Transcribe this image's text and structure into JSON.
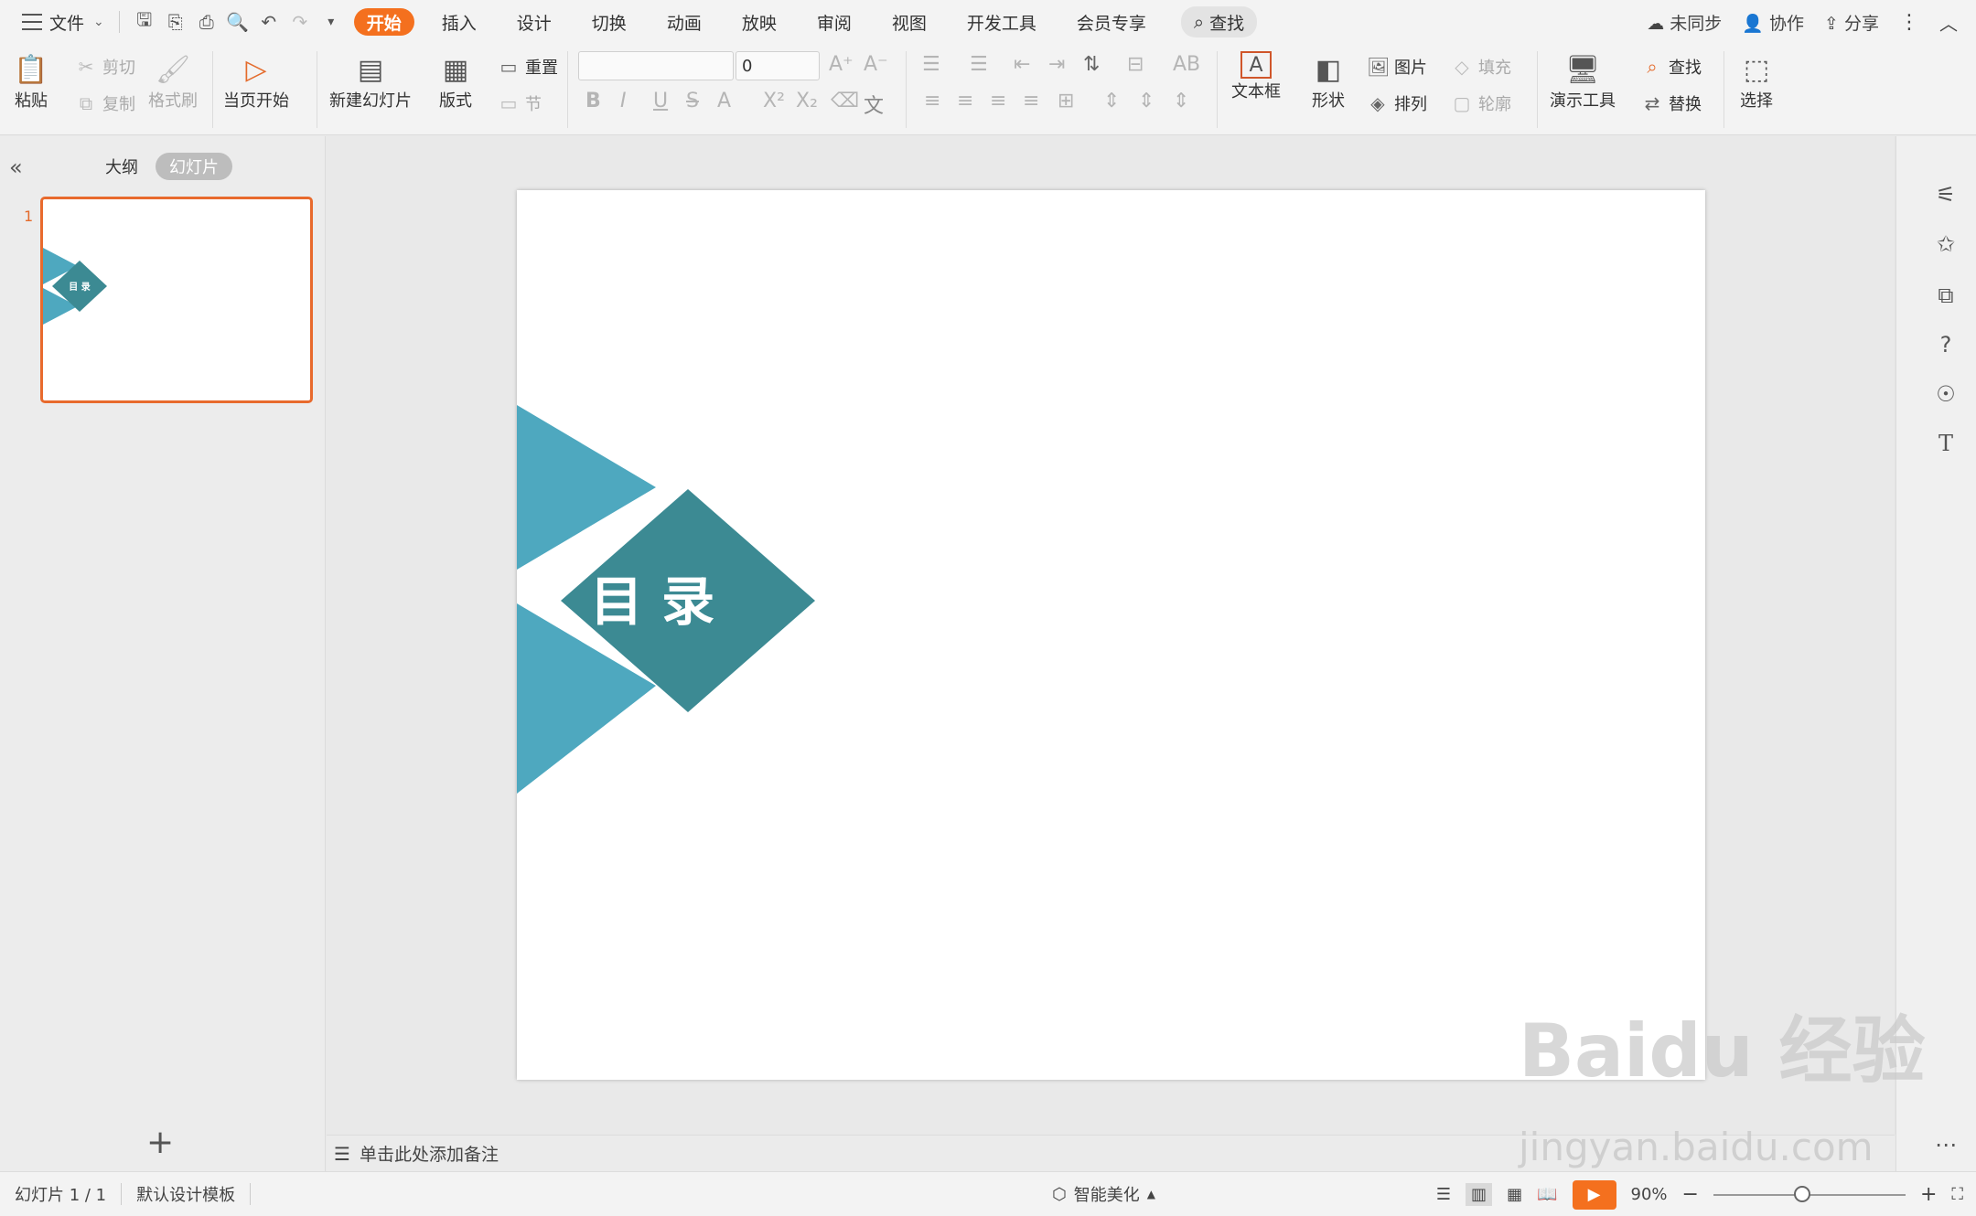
{
  "menu": {
    "file_label": "文件",
    "tabs": [
      "开始",
      "插入",
      "设计",
      "切换",
      "动画",
      "放映",
      "审阅",
      "视图",
      "开发工具",
      "会员专享"
    ],
    "active_tab": "开始",
    "search_label": "查找",
    "right": {
      "sync": "未同步",
      "collab": "协作",
      "share": "分享"
    }
  },
  "ribbon": {
    "paste": "粘贴",
    "cut": "剪切",
    "copy": "复制",
    "format_painter": "格式刷",
    "from_current": "当页开始",
    "new_slide": "新建幻灯片",
    "layout": "版式",
    "reset": "重置",
    "section": "节",
    "font_name": "",
    "font_size": "0",
    "textbox": "文本框",
    "shape": "形状",
    "picture": "图片",
    "arrange": "排列",
    "fill": "填充",
    "outline": "轮廓",
    "presentation_tools": "演示工具",
    "find": "查找",
    "replace": "替换",
    "select": "选择"
  },
  "left_panel": {
    "tab_outline": "大纲",
    "tab_slides": "幻灯片",
    "slide_number": "1"
  },
  "slide": {
    "title_text": "目  录",
    "colors": {
      "light_teal": "#4ea8bf",
      "dark_teal": "#3c8a93"
    }
  },
  "notes_placeholder": "单击此处添加备注",
  "status": {
    "slide_counter": "幻灯片 1 / 1",
    "template": "默认设计模板",
    "beautify": "智能美化",
    "zoom": "90%"
  },
  "watermark": {
    "line1": "Baidu 经验",
    "line2": "jingyan.baidu.com"
  }
}
